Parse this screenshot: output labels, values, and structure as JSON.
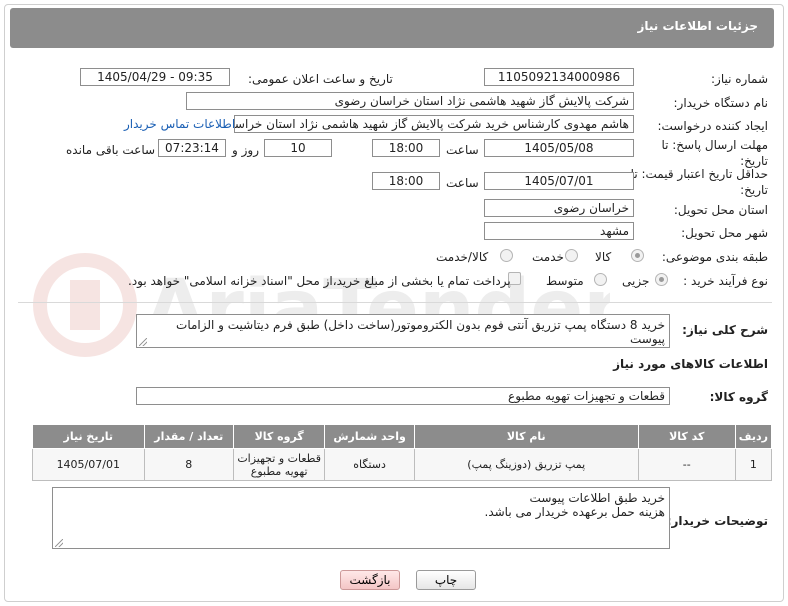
{
  "header": {
    "title": "جزئیات اطلاعات نیاز"
  },
  "form": {
    "need_number": {
      "label": "شماره نیاز:",
      "value": "1105092134000986"
    },
    "announce": {
      "label": "تاریخ و ساعت اعلان عمومی:",
      "value": "1405/04/29 - 09:35"
    },
    "buyer_org": {
      "label": "نام دستگاه خریدار:",
      "value": "شرکت پالایش گاز شهید هاشمی نژاد   استان خراسان رضوی"
    },
    "requester": {
      "label": "ایجاد کننده درخواست:",
      "value": "هاشم مهدوی کارشناس خرید شرکت پالایش گاز شهید هاشمی نژاد   استان خراسان رضوی",
      "contact_link": "اطلاعات تماس خریدار"
    },
    "reply_deadline": {
      "label": "مهلت ارسال پاسخ: تا تاریخ:",
      "date": "1405/05/08",
      "time_label": "ساعت",
      "time": "18:00",
      "days": "10",
      "days_label": "روز و",
      "remaining": "07:23:14",
      "remaining_label": "ساعت باقی مانده"
    },
    "price_validity": {
      "label": "حداقل تاریخ اعتبار قیمت: تا تاریخ:",
      "date": "1405/07/01",
      "time_label": "ساعت",
      "time": "18:00"
    },
    "province": {
      "label": "استان محل تحویل:",
      "value": "خراسان رضوی"
    },
    "city": {
      "label": "شهر محل تحویل:",
      "value": "مشهد"
    },
    "category": {
      "label": "طبقه بندی موضوعی:",
      "options": [
        "کالا",
        "خدمت",
        "کالا/خدمت"
      ],
      "selected": "کالا"
    },
    "purchase_type": {
      "label": "نوع فرآیند خرید :",
      "options": [
        "جزیی",
        "متوسط"
      ],
      "selected": "جزیی",
      "payment_note": "پرداخت تمام یا بخشی از مبلغ خرید،از محل \"اسناد خزانه اسلامی\" خواهد بود."
    },
    "description": {
      "label": "شرح کلی نیاز:",
      "value": "خرید 8 دستگاه پمپ تزریق آنتی فوم بدون الکتروموتور(ساخت داخل) طبق فرم دیتاشیت و الزامات پیوست"
    }
  },
  "goods": {
    "section_title": "اطلاعات کالاهای مورد نیاز",
    "group_label": "گروه کالا:",
    "group_value": "قطعات و تجهیزات تهویه مطبوع",
    "columns": [
      "ردیف",
      "کد کالا",
      "نام کالا",
      "واحد شمارش",
      "گروه کالا",
      "تعداد / مقدار",
      "تاریخ نیاز"
    ],
    "rows": [
      [
        "1",
        "--",
        "پمپ تزریق (دوزینگ پمپ)",
        "دستگاه",
        "قطعات و تجهیزات تهویه مطبوع",
        "8",
        "1405/07/01"
      ]
    ]
  },
  "buyer_notes": {
    "label": "توضیحات خریدار:",
    "lines": [
      "خرید طبق اطلاعات پیوست",
      "هزینه حمل برعهده خریدار می باشد."
    ]
  },
  "buttons": {
    "print": "چاپ",
    "back": "بازگشت"
  },
  "watermark": {
    "text": "AriaTender.net"
  }
}
